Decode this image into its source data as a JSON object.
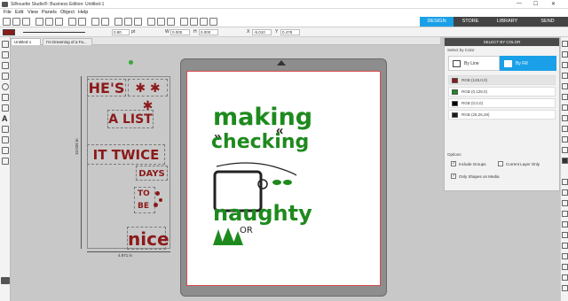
{
  "window": {
    "title": "Silhouette Studio®: Business Edition: Untitled-1",
    "controls": [
      "—",
      "☐",
      "✕"
    ]
  },
  "menu": [
    "File",
    "Edit",
    "View",
    "Panels",
    "Object",
    "Help"
  ],
  "nav_tabs": [
    {
      "label": "DESIGN",
      "color": "#1aa0e8"
    },
    {
      "label": "STORE",
      "color": "#444444"
    },
    {
      "label": "LIBRARY",
      "color": "#444444"
    },
    {
      "label": "SEND",
      "color": "#444444"
    }
  ],
  "props": {
    "stroke": "0.80",
    "unit": "pt",
    "w_label": "W",
    "w": "0.000",
    "h_label": "H",
    "h": "0.000",
    "x_label": "X",
    "x": "-5.010",
    "y_label": "Y",
    "y": "0.478"
  },
  "doc_tabs": [
    "Untitled-1",
    "I'm Dreaming of a Fa..."
  ],
  "canvas": {
    "dim_width": "4.971 in",
    "dim_height": "10.026 in"
  },
  "left_art": {
    "hes": "HE'S",
    "alist": "A LIST",
    "ittwice": "IT TWICE",
    "days": "DAYS",
    "tobe": "TO BE",
    "nice": "nice",
    "stars": "✱ ✱ ✱"
  },
  "page_art": {
    "making": "making",
    "checking": "checking",
    "naughty": "naughty",
    "or": "OR",
    "arrows": "»",
    "quotes": "«"
  },
  "panel": {
    "title": "SELECT BY COLOR",
    "subtitle": "Select by Color",
    "by_line": "By Line",
    "by_fill": "By Fill",
    "swatches": [
      {
        "label": "RGB (128,0,0)",
        "color": "#8b1a1a"
      },
      {
        "label": "RGB (0,128,0)",
        "color": "#1e8a1e"
      },
      {
        "label": "RGB (0,0,0)",
        "color": "#000000"
      },
      {
        "label": "RGB (26,26,26)",
        "color": "#1a1a1a"
      }
    ],
    "options_label": "Options",
    "include_groups": "Include Groups",
    "current_layer": "Current Layer Only",
    "only_shapes": "Only Shapes on Media"
  },
  "fill_color": "#8b1a1a"
}
